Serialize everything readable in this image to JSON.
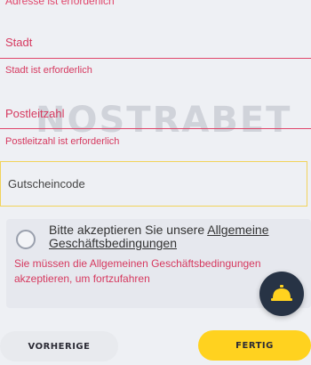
{
  "form": {
    "address_error": "Adresse ist erforderlich",
    "city": {
      "label": "Stadt",
      "error": "Stadt ist erforderlich"
    },
    "zip": {
      "label": "Postleitzahl",
      "error": "Postleitzahl ist erforderlich"
    },
    "voucher": {
      "placeholder": "Gutscheincode",
      "value": ""
    },
    "terms": {
      "text_prefix": "Bitte akzeptieren Sie unsere",
      "link_text": "Allgemeine Geschäftsbedingungen",
      "checked": false,
      "error": "Sie müssen die Allgemeinen Geschäftsbedingungen akzeptieren, um fortzufahren"
    }
  },
  "watermark": "NOSTRABET",
  "support": {
    "icon": "service-bell-icon"
  },
  "actions": {
    "prev_label": "VORHERIGE",
    "done_label": "FERTIG"
  },
  "colors": {
    "error": "#d6395f",
    "accent_yellow": "#ffd21f",
    "support_bg": "#273345"
  }
}
